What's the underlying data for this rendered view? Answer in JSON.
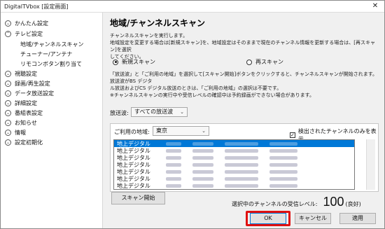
{
  "window": {
    "title": "DigitalTVbox [設定画面]",
    "close_glyph": "✕"
  },
  "sidebar": {
    "items": [
      {
        "label": "かんたん設定",
        "icon": "chevron-down-icon",
        "glyph": "⌄"
      },
      {
        "label": "テレビ設定",
        "icon": "chevron-up-icon",
        "glyph": "⌃"
      },
      {
        "label": "視聴設定",
        "icon": "chevron-down-icon",
        "glyph": "⌄"
      },
      {
        "label": "録画/再生設定",
        "icon": "chevron-down-icon",
        "glyph": "⌄"
      },
      {
        "label": "データ放送設定",
        "icon": "chevron-down-icon",
        "glyph": "⌄"
      },
      {
        "label": "詳細設定",
        "icon": "chevron-down-icon",
        "glyph": "⌄"
      },
      {
        "label": "番組表設定",
        "icon": "chevron-down-icon",
        "glyph": "⌄"
      },
      {
        "label": "お知らせ",
        "icon": "chevron-down-icon",
        "glyph": "⌄"
      },
      {
        "label": "情報",
        "icon": "chevron-down-icon",
        "glyph": "⌄"
      },
      {
        "label": "設定初期化",
        "icon": "chevron-down-icon",
        "glyph": "⌄"
      }
    ],
    "subitems": [
      {
        "label": "地域/チャンネルスキャン"
      },
      {
        "label": "チューナー/アンテナ"
      },
      {
        "label": "リモコンボタン割り当て"
      }
    ]
  },
  "main": {
    "title": "地域/チャンネルスキャン",
    "intro_line1": "チャンネルスキャンを実行します。",
    "intro_line2": "地域設定を変更する場合は[新規スキャン]を、地域設定はそのままで現在のチャンネル情報を更新する場合は、[再スキャン]を選択",
    "intro_line3": "してください。",
    "radio_new": "新規スキャン",
    "radio_rescan": "再スキャン",
    "desc_line1": "「放送波」と「ご利用の地域」を選択して[スキャン開始]ボタンをクリックすると、チャンネルスキャンが開始されます。放送波がBS デジタ",
    "desc_line2": "ル放送およびCS デジタル放送のときは、「ご利用の地域」の選択は不要です。",
    "note": "※チャンネルスキャンの実行中や受信レベルの確認中は予約録画ができない場合があります。",
    "broadcast_label": "放送波:",
    "broadcast_value": "すべての放送波",
    "region_label": "ご利用の地域:",
    "region_value": "東京",
    "checkbox_label": "検出されたチャンネルのみを表示",
    "checkbox_checked": true,
    "checkbox_glyph": "✓",
    "dropdown_glyph": "⌄",
    "channels": [
      {
        "type": "地上デジタル"
      },
      {
        "type": "地上デジタル"
      },
      {
        "type": "地上デジタル"
      },
      {
        "type": "地上デジタル"
      },
      {
        "type": "地上デジタル"
      },
      {
        "type": "地上デジタル"
      },
      {
        "type": "地上デジタル"
      }
    ],
    "scan_button": "スキャン開始",
    "level_label": "選択中のチャンネルの受信レベル:",
    "level_value": "100",
    "level_status": "(良好)"
  },
  "footer": {
    "ok": "OK",
    "cancel": "キャンセル",
    "apply": "適用"
  },
  "colors": {
    "accent": "#0078d7",
    "highlight": "#e01010"
  }
}
